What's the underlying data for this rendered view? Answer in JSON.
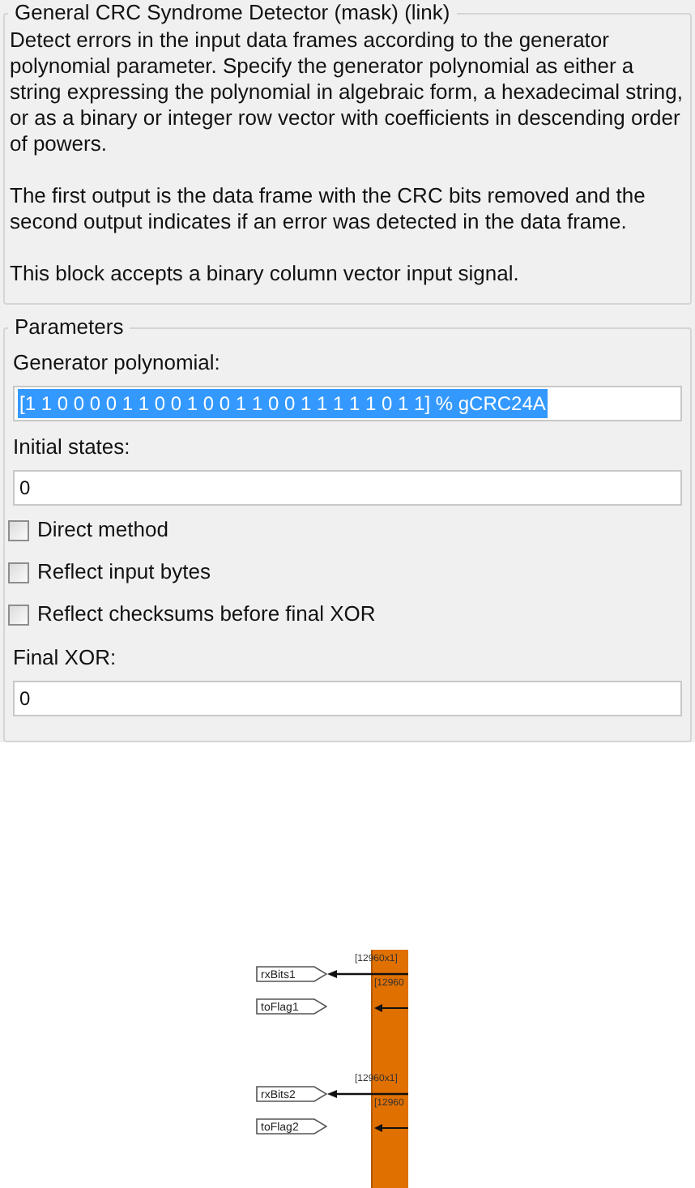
{
  "description": {
    "title": "General CRC Syndrome Detector (mask) (link)",
    "paragraphs": [
      "Detect errors in the input data frames according to the generator polynomial parameter. Specify the generator polynomial as either a string expressing the polynomial in algebraic form, a hexadecimal string, or as a binary or integer row vector with coefficients in descending order of powers.",
      "The first output is the data frame with the CRC bits removed and the second output indicates if an error was detected in the data frame.",
      "This block accepts a binary column vector input signal."
    ]
  },
  "parameters": {
    "title": "Parameters",
    "fields": [
      {
        "kind": "text",
        "label": "Generator polynomial:",
        "value": "[1 1 0 0 0 0 1 1 0 0 1 0 0 1 1 0 0  1 1 1 1 1 0 1 1] % gCRC24A",
        "selected": true
      },
      {
        "kind": "text",
        "label": "Initial states:",
        "value": "0",
        "selected": false
      },
      {
        "kind": "checkbox",
        "label": "Direct method",
        "checked": false
      },
      {
        "kind": "checkbox",
        "label": "Reflect input bytes",
        "checked": false
      },
      {
        "kind": "checkbox",
        "label": "Reflect checksums before final XOR",
        "checked": false
      },
      {
        "kind": "text",
        "label": "Final XOR:",
        "value": "0",
        "selected": false
      }
    ]
  },
  "diagram": {
    "ports": [
      {
        "dims": "[12960x1]",
        "dims_cut": "[12960",
        "data_tag": "rxBits1",
        "flag_tag": "toFlag1"
      },
      {
        "dims": "[12960x1]",
        "dims_cut": "[12960",
        "data_tag": "rxBits2",
        "flag_tag": "toFlag2"
      }
    ]
  }
}
